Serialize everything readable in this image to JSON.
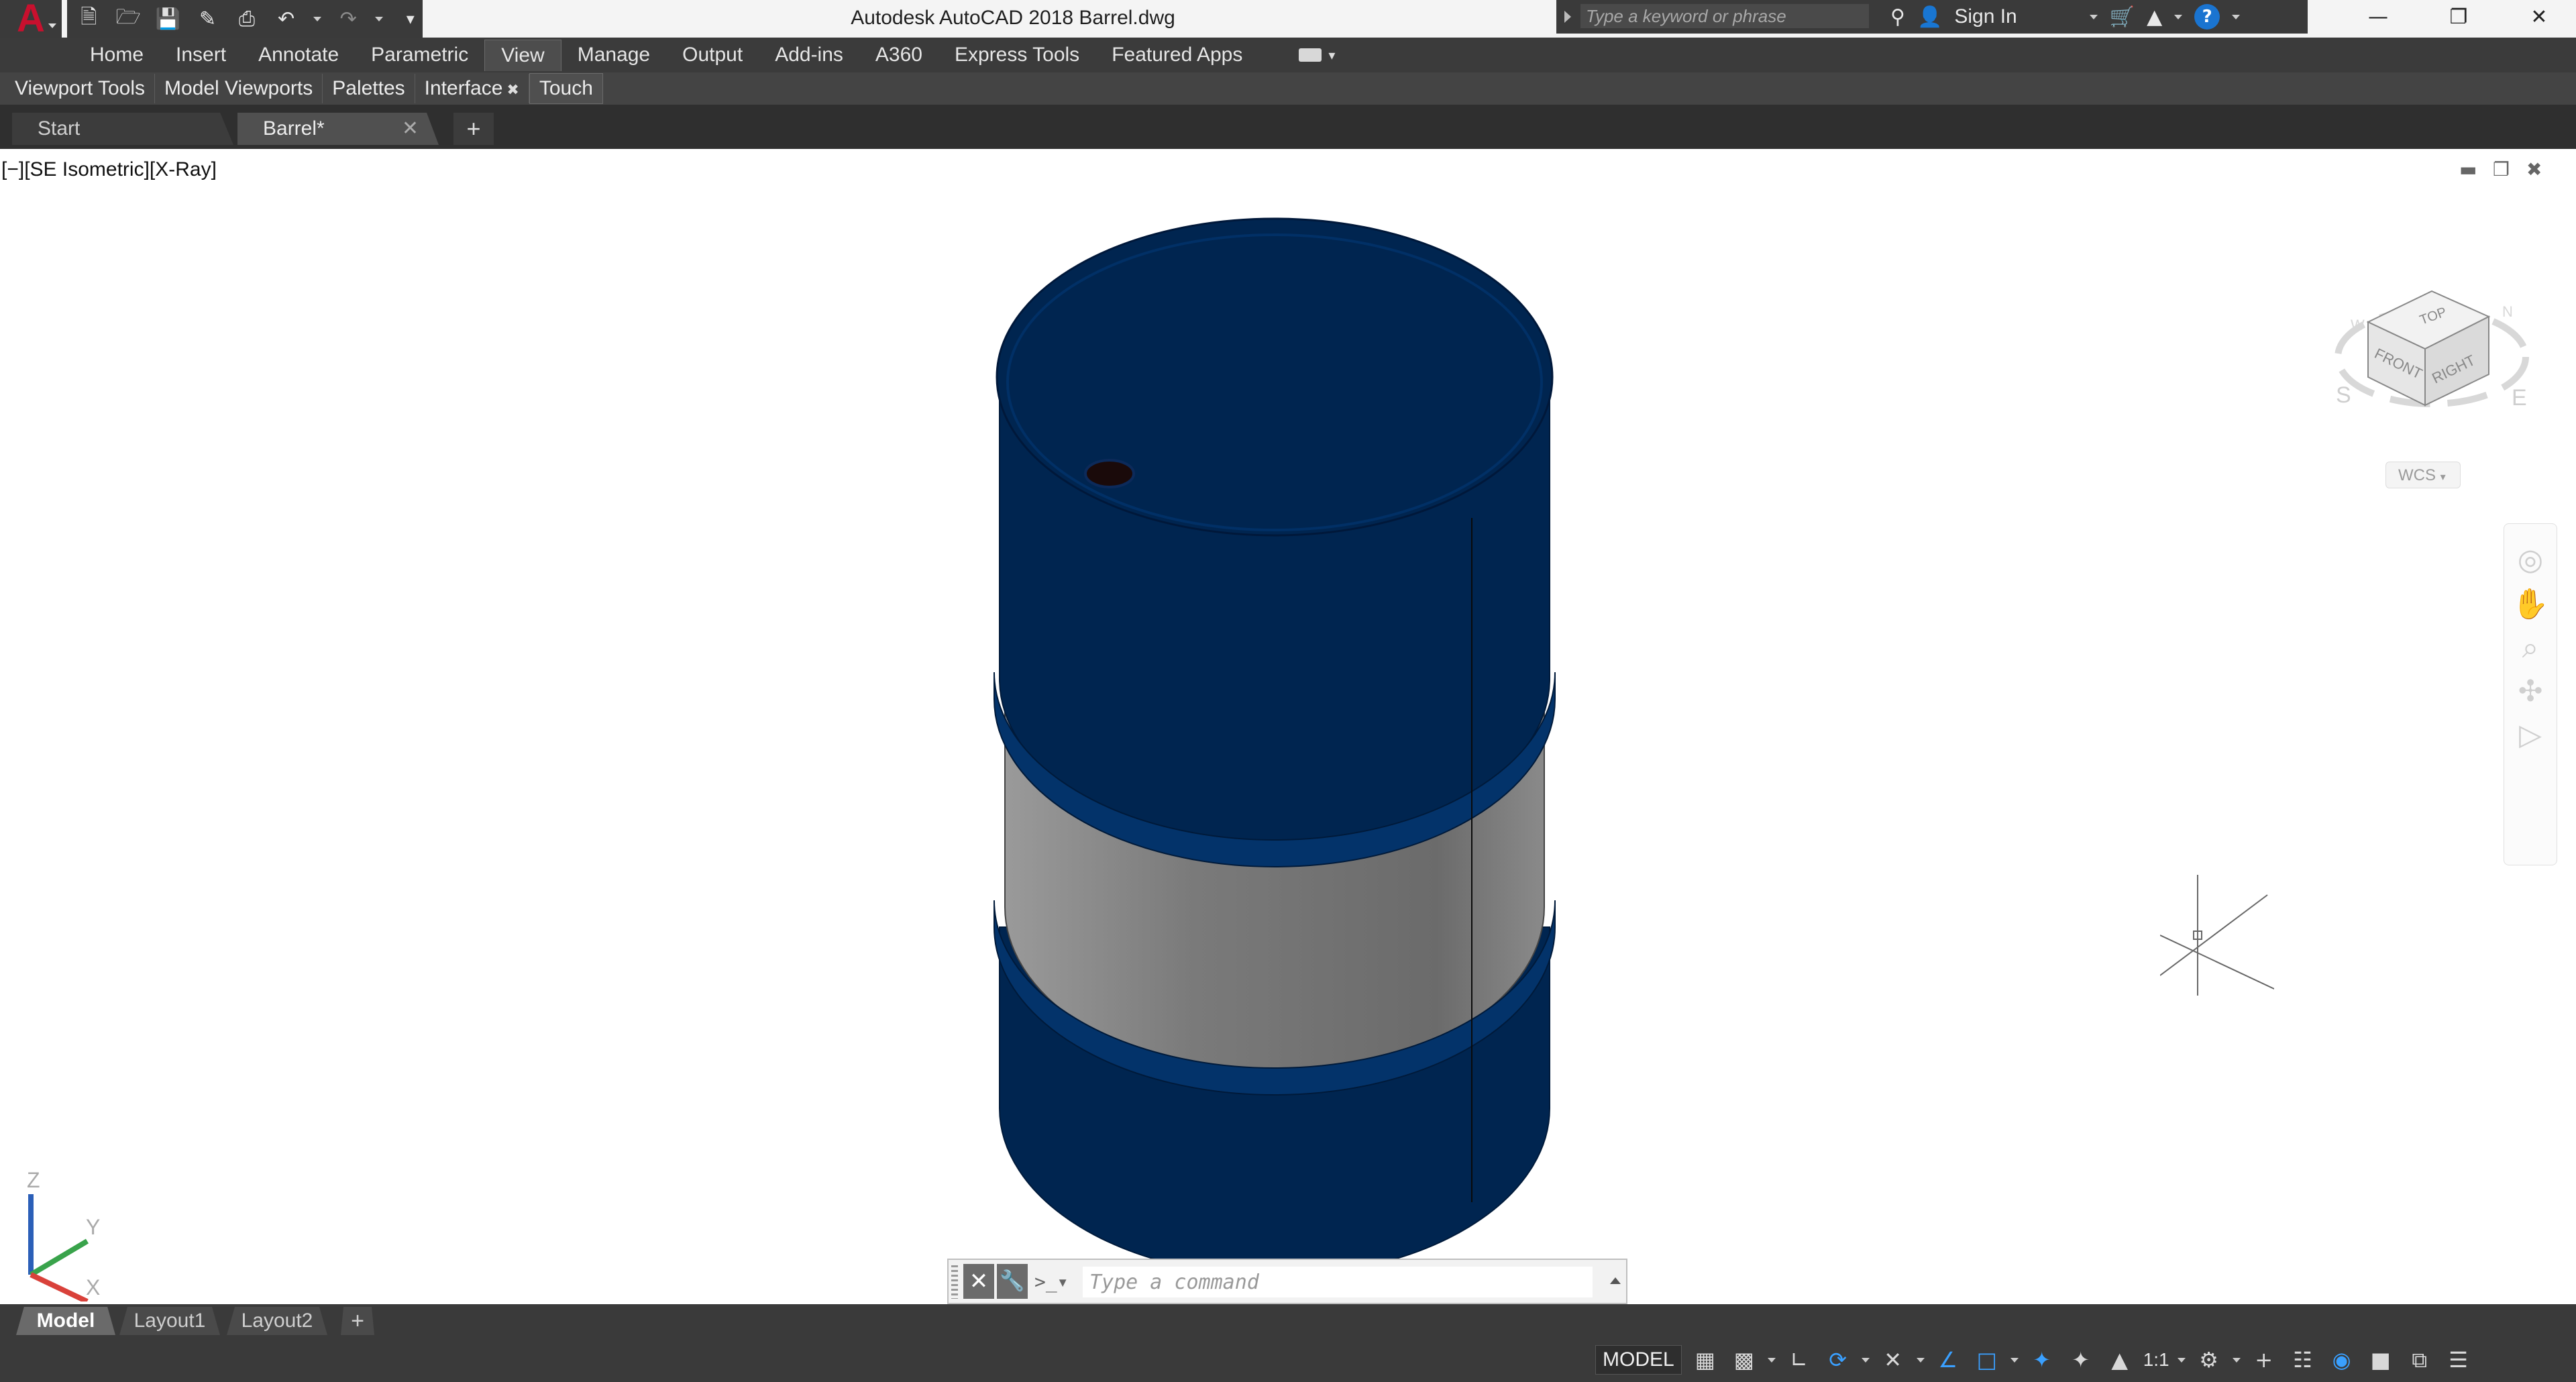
{
  "app": {
    "logo_letter": "A",
    "window_title": "Autodesk AutoCAD 2018    Barrel.dwg"
  },
  "qat": {
    "icons": [
      "new-icon",
      "open-icon",
      "save-icon",
      "save-as-icon",
      "print-icon",
      "undo-icon",
      "redo-icon",
      "customize-icon"
    ]
  },
  "search": {
    "placeholder": "Type a keyword or phrase"
  },
  "account": {
    "sign_in": "Sign In"
  },
  "ribbon": {
    "tabs": [
      "Home",
      "Insert",
      "Annotate",
      "Parametric",
      "View",
      "Manage",
      "Output",
      "Add-ins",
      "A360",
      "Express Tools",
      "Featured Apps"
    ],
    "active": "View"
  },
  "panels": [
    "Viewport Tools",
    "Model Viewports",
    "Palettes",
    "Interface",
    "Touch"
  ],
  "file_tabs": {
    "start": "Start",
    "current": "Barrel*"
  },
  "viewport": {
    "label": "[−][SE Isometric][X-Ray]",
    "viewcube": {
      "top": "TOP",
      "front": "FRONT",
      "right": "RIGHT",
      "south": "S",
      "east": "E",
      "west": "W",
      "north": "N"
    },
    "wcs": "WCS",
    "ucs": {
      "x": "X",
      "y": "Y",
      "z": "Z"
    }
  },
  "command": {
    "placeholder": "Type a command"
  },
  "layout_tabs": [
    "Model",
    "Layout1",
    "Layout2"
  ],
  "status": {
    "model": "MODEL",
    "scale": "1:1"
  },
  "colors": {
    "barrel_blue": "#002550",
    "band_gray": "#7a7a7a",
    "ui_dark": "#3a3a3a"
  }
}
